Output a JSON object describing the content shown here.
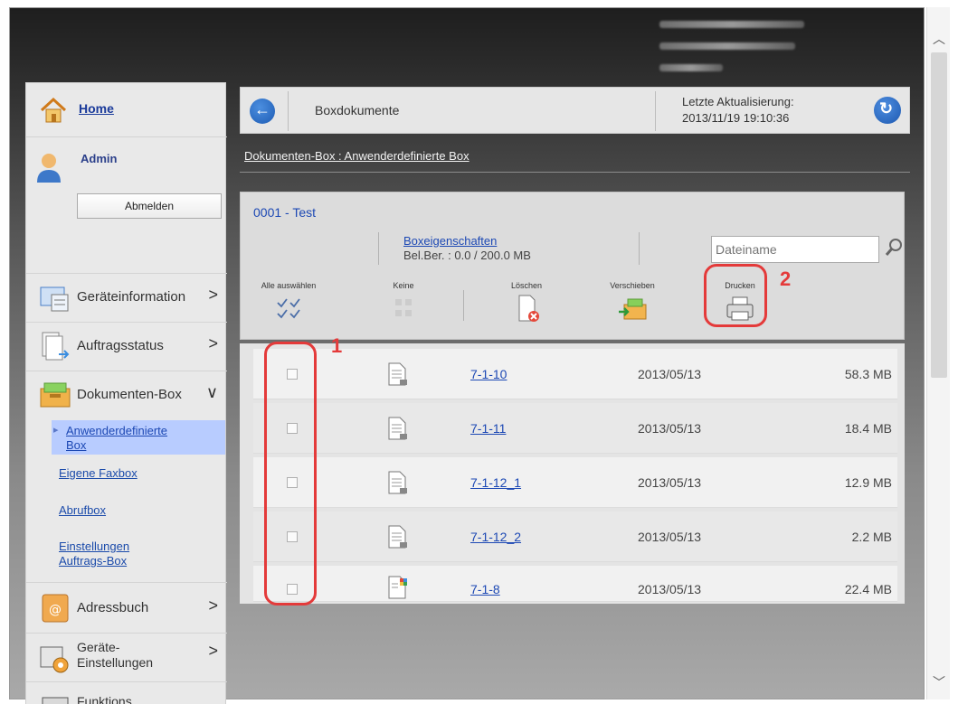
{
  "sidebar": {
    "home_label": "Home",
    "user_label": "Admin",
    "logout_label": "Abmelden",
    "nav": [
      {
        "label": "Geräteinformation",
        "icon": "device-info-icon"
      },
      {
        "label": "Auftragsstatus",
        "icon": "job-status-icon"
      },
      {
        "label": "Dokumenten-Box",
        "icon": "document-box-icon"
      },
      {
        "label": "Adressbuch",
        "icon": "address-book-icon"
      },
      {
        "label": "Geräte-",
        "label2": "Einstellungen",
        "icon": "device-settings-icon"
      },
      {
        "label": "Funktions",
        "icon": "function-icon"
      }
    ],
    "doc_box_sub": {
      "active_line1": "Anwenderdefinierte",
      "active_line2": "Box",
      "fax": "Eigene Faxbox",
      "polling": "Abrufbox",
      "settings_line1": "Einstellungen",
      "settings_line2": "Auftrags-Box"
    }
  },
  "header": {
    "title": "Boxdokumente",
    "updated_label": "Letzte Aktualisierung:",
    "updated_value": "2013/11/19 19:10:36"
  },
  "breadcrumb": "Dokumenten-Box : Anwenderdefinierte Box",
  "box": {
    "name": "0001 - Test",
    "properties_link": "Boxeigenschaften",
    "usage": "Bel.Ber. : 0.0 / 200.0 MB",
    "filename_placeholder": "Dateiname"
  },
  "toolbar": {
    "select_all": "Alle auswählen",
    "none": "Keine",
    "delete": "Löschen",
    "move": "Verschieben",
    "print": "Drucken"
  },
  "files": [
    {
      "name": "7-1-10",
      "date": "2013/05/13",
      "size": "58.3 MB"
    },
    {
      "name": "7-1-11",
      "date": "2013/05/13",
      "size": "18.4 MB"
    },
    {
      "name": "7-1-12_1",
      "date": "2013/05/13",
      "size": "12.9 MB"
    },
    {
      "name": "7-1-12_2",
      "date": "2013/05/13",
      "size": "2.2 MB"
    },
    {
      "name": "7-1-8",
      "date": "2013/05/13",
      "size": "22.4 MB"
    }
  ],
  "annotations": {
    "one": "1",
    "two": "2"
  },
  "colors": {
    "accent": "#1c48b4",
    "highlight": "#e43a3a",
    "active_bg": "#b8ccff"
  }
}
